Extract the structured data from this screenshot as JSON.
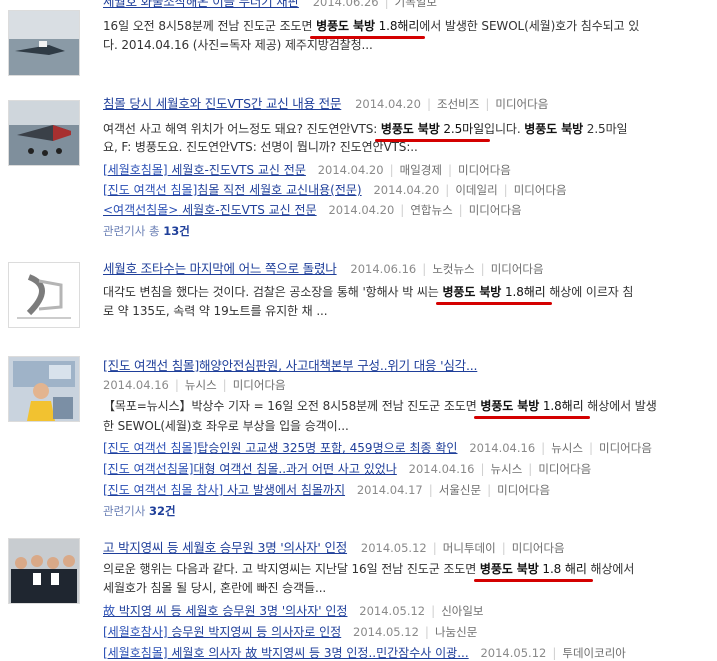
{
  "items": [
    {
      "title": "세월호 화물조작해온 이들 무더기 재판",
      "date": "2014.06.26",
      "source": "기독일보",
      "snippet_pre": "16일 오전 8시58분께 전남 진도군 조도면 ",
      "snippet_hl1": "병풍도 북방",
      "snippet_hl2": "1.8해리",
      "snippet_post": "에서 발생한 SEWOL(세월)호가 침수되고 있",
      "snippet_line2": "다. 2014.04.16 (사진=독자 제공) 제주지방검찰청..."
    },
    {
      "title": "침몰 당시 세월호와 진도VTS간 교신 내용 전문",
      "date": "2014.04.20",
      "source": "조선비즈",
      "portal": "미디어다음",
      "snippet_pre": "여객선 사고 해역 위치가 어느정도 돼요? 진도연안VTS: ",
      "snippet_hl1": "병풍도 북방",
      "snippet_hl2": "2.5마일",
      "snippet_post": "입니다. ",
      "snippet_hl3": "병풍도 북방",
      "snippet_tail": " 2.5마일",
      "snippet_line2": "요, F: 병풍도요. 진도연안VTS: 선명이 뭡니까? 진도연안VTS:..",
      "subs": [
        {
          "bracket": "[세월호침몰]",
          "text": " 세월호-진도VTS 교신 전문",
          "date": "2014.04.20",
          "source": "매일경제",
          "portal": "미디어다음"
        },
        {
          "bracket": "[진도 여객선 침몰]",
          "text": "침몰 직전 세월호 교신내용(전문)",
          "date": "2014.04.20",
          "source": "이데일리",
          "portal": "미디어다음"
        },
        {
          "bracket": "<여객선침몰>",
          "text": " 세월호-진도VTS 교신 전문",
          "date": "2014.04.20",
          "source": "연합뉴스",
          "portal": "미디어다음"
        }
      ],
      "related_label": "관련기사 총 ",
      "related_count": "13건"
    },
    {
      "title": "세월호 조타수는 마지막에 어느 쪽으로 돌렸나",
      "date": "2014.06.16",
      "source": "노컷뉴스",
      "portal": "미디어다음",
      "snippet_pre": "대각도 변침을 했다는 것이다. 검찰은 공소장을 통해 '항해사 박 씨는 ",
      "snippet_hl1": "병풍도 북방",
      "snippet_hl2": "1.8해리",
      "snippet_post": " 해상에 이르자 침",
      "snippet_line2": "로 약 135도, 속력 약 19노트를 유지한 채 ..."
    },
    {
      "title": "[진도 여객선 침몰]해양안전심판원, 사고대책본부 구성..위기 대응 '심각...",
      "date": "2014.04.16",
      "source": "뉴시스",
      "portal": "미디어다음",
      "snippet_pre": "【목포=뉴시스】박상수 기자 = 16일 오전 8시58분께 전남 진도군 조도면 ",
      "snippet_hl1": "병풍도 북방",
      "snippet_hl2": "1.8해리",
      "snippet_post": " 해상에서 발생",
      "snippet_line2": "한 SEWOL(세월)호 좌우로 부상을 입을 승객이...",
      "subs": [
        {
          "bracket": "[진도 여객선 침몰]",
          "text": "탑승인원 고교생 325명 포함, 459명으로 최종 확인",
          "date": "2014.04.16",
          "source": "뉴시스",
          "portal": "미디어다음"
        },
        {
          "bracket": "[진도 여객선침몰]",
          "text": "대형 여객선 침몰..과거 어떤 사고 있었나",
          "date": "2014.04.16",
          "source": "뉴시스",
          "portal": "미디어다음"
        },
        {
          "bracket": "[진도 여객선 침몰 참사]",
          "text": " 사고 발생에서 침몰까지",
          "date": "2014.04.17",
          "source": "서울신문",
          "portal": "미디어다음"
        }
      ],
      "related_label": "관련기사 ",
      "related_count": "32건"
    },
    {
      "title": "고 박지영씨 등 세월호 승무원 3명 '의사자' 인정",
      "date": "2014.05.12",
      "source": "머니투데이",
      "portal": "미디어다음",
      "snippet_pre": "의로운 행위는 다음과 같다. 고 박지영씨는 지난달 16일 전남 진도군 조도면 ",
      "snippet_hl1": "병풍도 북방",
      "snippet_hl2": "1.8 해리",
      "snippet_post": " 해상에서",
      "snippet_line2": "세월호가 침몰 될 당시, 혼란에 빠진 승객들...",
      "subs": [
        {
          "bracket": "故",
          "text": " 박지영 씨 등 세월호 승무원 3명 '의사자' 인정",
          "date": "2014.05.12",
          "source": "신아일보",
          "portal": ""
        },
        {
          "bracket": "[세월호참사]",
          "text": " 승무원 박지영씨 등 의사자로 인정",
          "date": "2014.05.12",
          "source": "나눔신문",
          "portal": ""
        },
        {
          "bracket": "[세월호침몰]",
          "text": " 세월호 의사자 故 박지영씨 등 3명 인정..민간잠수사 이광...",
          "date": "2014.05.12",
          "source": "투데이코리아",
          "portal": ""
        }
      ]
    }
  ],
  "colors": {
    "link": "#1f3f9a",
    "meta": "#8a8a8a",
    "highlight_underline": "#d40000"
  }
}
